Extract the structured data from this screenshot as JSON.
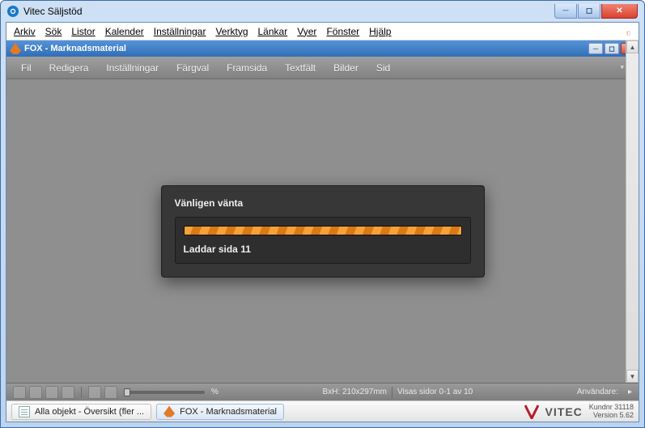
{
  "window": {
    "title": "Vitec Säljstöd"
  },
  "menus": [
    "Arkiv",
    "Sök",
    "Listor",
    "Kalender",
    "Inställningar",
    "Verktyg",
    "Länkar",
    "Vyer",
    "Fönster",
    "Hjälp"
  ],
  "child": {
    "title": "FOX - Marknadsmaterial",
    "toolbar": [
      "Fil",
      "Redigera",
      "Inställningar",
      "Färgval",
      "Framsida",
      "Textfält",
      "Bilder",
      "Sid"
    ]
  },
  "modal": {
    "header": "Vänligen vänta",
    "message": "Laddar sida 11"
  },
  "foxStatus": {
    "dims": "BxH: 210x297mm",
    "pages": "Visas sidor 0-1 av 10",
    "zoom": "%",
    "user": "Användare:"
  },
  "taskbar": {
    "tab1": "Alla objekt - Översikt (fler ...",
    "tab2": "FOX - Marknadsmaterial"
  },
  "brand": {
    "name": "VITEC",
    "customer": "Kundnr 31118",
    "version": "Version 5.62"
  }
}
